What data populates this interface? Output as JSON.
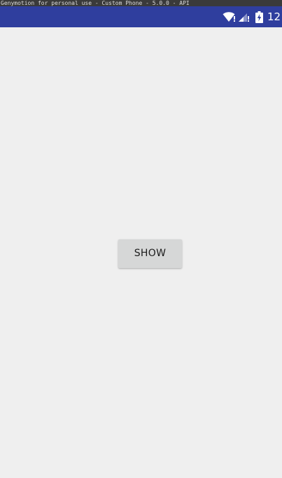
{
  "emulator_title": "Genymotion for personal use - Custom Phone - 5.0.0 - API",
  "status_bar": {
    "icons": [
      "wifi-icon",
      "signal-icon",
      "battery-charging-icon"
    ],
    "clock": "12",
    "background_color": "#2f3e9e"
  },
  "main": {
    "background_color": "#efefef",
    "show_button_label": "SHOW"
  }
}
